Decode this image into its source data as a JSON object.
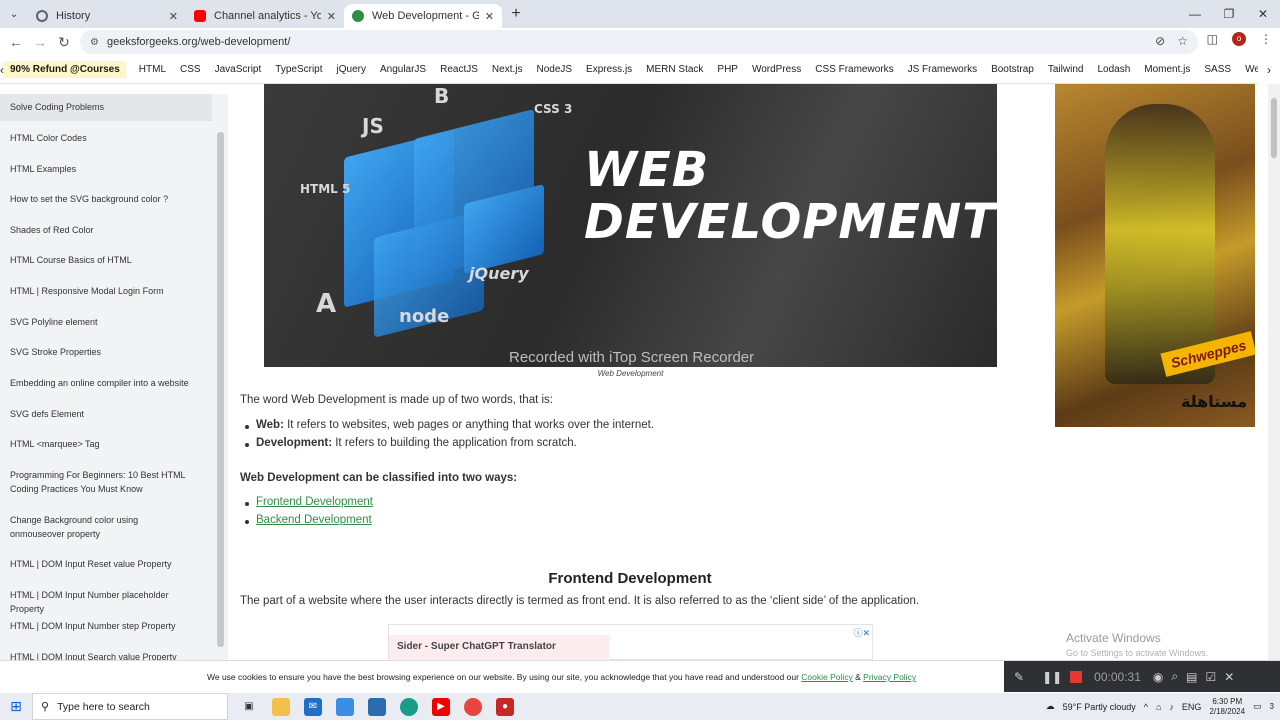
{
  "browser": {
    "tabs": [
      {
        "title": "History",
        "icon_color": "#5f6368",
        "active": false
      },
      {
        "title": "Channel analytics - YouTube Stu",
        "icon_color": "#ff0000",
        "active": false
      },
      {
        "title": "Web Development - GeeksforG",
        "icon_color": "#2f8d46",
        "active": true
      }
    ],
    "new_tab_icon": "+",
    "url": "geeksforgeeks.org/web-development/",
    "profile_initial": "o"
  },
  "gfg_nav": {
    "promo": "90% Refund @Courses",
    "items": [
      "HTML",
      "CSS",
      "JavaScript",
      "TypeScript",
      "jQuery",
      "AngularJS",
      "ReactJS",
      "Next.js",
      "NodeJS",
      "Express.js",
      "MERN Stack",
      "PHP",
      "WordPress",
      "CSS Frameworks",
      "JS Frameworks",
      "Bootstrap",
      "Tailwind",
      "Lodash",
      "Moment.js",
      "SASS",
      "Web Development"
    ]
  },
  "sidebar": {
    "items": [
      "Solve Coding Problems",
      "HTML Color Codes",
      "HTML Examples",
      "How to set the SVG background color ?",
      "Shades of Red Color",
      "HTML Course Basics of HTML",
      "HTML | Responsive Modal Login Form",
      "SVG Polyline element",
      "SVG Stroke Properties",
      "Embedding an online compiler into a website",
      "SVG defs Element",
      "HTML <marquee> Tag",
      "Programming For Beginners: 10 Best HTML Coding Practices You Must Know",
      "Change Background color using onmouseover property",
      "HTML | DOM Input Reset value Property",
      "HTML | DOM Input Number placeholder Property",
      "HTML | DOM Input Number step Property",
      "HTML | DOM Input Search value Property"
    ]
  },
  "hero": {
    "title_line1": "WEB",
    "title_line2": "DEVELOPMENT",
    "watermark": "Recorded with iTop Screen Recorder",
    "labels": [
      "JS",
      "B",
      "CSS 3",
      "HTML 5",
      "jQuery",
      "A",
      "node"
    ],
    "caption": "Web Development"
  },
  "article": {
    "intro": "The word Web Development is made up of two words, that is:",
    "bullets": [
      {
        "term": "Web:",
        "text": " It refers to websites, web pages or anything that works over the internet."
      },
      {
        "term": "Development:",
        "text": " It refers to building the application from scratch."
      }
    ],
    "classified_heading": "Web Development can be classified into two ways:",
    "links": [
      "Frontend Development",
      "Backend Development"
    ],
    "section_heading": "Frontend Development",
    "section_text": "The part of a website where the user interacts directly is termed as front end. It is also referred to as the ‘client side’ of the application."
  },
  "ad": {
    "inline_text": "Sider - Super ChatGPT Translator",
    "side_brand": "Schweppes",
    "side_arabic": "مستاهلة"
  },
  "windows_watermark": {
    "line1": "Activate Windows",
    "line2": "Go to Settings to activate Windows."
  },
  "cookie": {
    "text": "We use cookies to ensure you have the best browsing experience on our website. By using our site, you acknowledge that you have read and understood our ",
    "link1": "Cookie Policy",
    "amp": " & ",
    "link2": "Privacy Policy"
  },
  "recorder": {
    "time": "00:00:31"
  },
  "taskbar": {
    "search_placeholder": "Type here to search",
    "weather": "59°F  Partly cloudy",
    "lang": "ENG",
    "time": "6:30 PM",
    "date": "2/18/2024",
    "notification_count": "3"
  }
}
